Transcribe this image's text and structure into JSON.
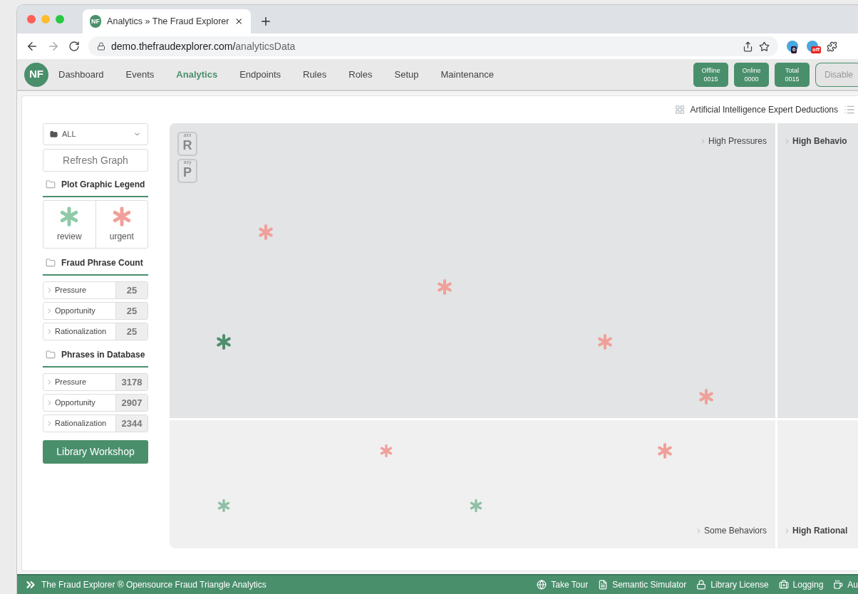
{
  "browser": {
    "favicon_text": "NF",
    "tab_title": "Analytics » The Fraud Explorer",
    "url_host": "demo.thefraudexplorer.com/",
    "url_path": "analyticsData",
    "extension_badges": [
      {
        "text": "0",
        "color": "#2a1636"
      },
      {
        "text": "off",
        "color": "#e8231c"
      }
    ]
  },
  "nav": {
    "logo": "NF",
    "items": [
      {
        "label": "Dashboard",
        "selected": false
      },
      {
        "label": "Events",
        "selected": false
      },
      {
        "label": "Analytics",
        "selected": true
      },
      {
        "label": "Endpoints",
        "selected": false
      },
      {
        "label": "Rules",
        "selected": false
      },
      {
        "label": "Roles",
        "selected": false
      },
      {
        "label": "Setup",
        "selected": false
      },
      {
        "label": "Maintenance",
        "selected": false
      }
    ],
    "status": [
      {
        "label": "Offline",
        "value": "0015"
      },
      {
        "label": "Online",
        "value": "0000"
      },
      {
        "label": "Total",
        "value": "0015"
      }
    ],
    "disable_button": "Disable"
  },
  "toolbar": {
    "title": "Artificial Intelligence Expert Deductions"
  },
  "sidebar": {
    "filter": "ALL",
    "refresh_button": "Refresh Graph",
    "legend": {
      "title": "Plot Graphic Legend",
      "items": [
        {
          "label": "review",
          "color": "#8fc9a8"
        },
        {
          "label": "urgent",
          "color": "#f0a09a"
        }
      ]
    },
    "sections": [
      {
        "title": "Fraud Phrase Count",
        "rows": [
          {
            "label": "Pressure",
            "value": "25"
          },
          {
            "label": "Opportunity",
            "value": "25"
          },
          {
            "label": "Rationalization",
            "value": "25"
          }
        ]
      },
      {
        "title": "Phrases in Database",
        "rows": [
          {
            "label": "Pressure",
            "value": "3178"
          },
          {
            "label": "Opportunity",
            "value": "2907"
          },
          {
            "label": "Rationalization",
            "value": "2344"
          }
        ]
      }
    ],
    "library_button": "Library Workshop"
  },
  "plot": {
    "axes": [
      {
        "caption": "axx",
        "letter": "R"
      },
      {
        "caption": "axy",
        "letter": "P"
      }
    ],
    "quadrants": [
      {
        "label": "High Pressures",
        "bold": false
      },
      {
        "label": "High Behavio",
        "bold": true
      },
      {
        "label": "Some Behaviors",
        "bold": false
      },
      {
        "label": "High Rational",
        "bold": true
      }
    ]
  },
  "footer": {
    "title": "The Fraud Explorer ® Opensource Fraud Triangle Analytics",
    "links": [
      {
        "kind": "globe",
        "label": "Take Tour"
      },
      {
        "kind": "document",
        "label": "Semantic Simulator"
      },
      {
        "kind": "lock",
        "label": "Library License"
      },
      {
        "kind": "medkit",
        "label": "Logging"
      },
      {
        "kind": "cup",
        "label": "Au"
      }
    ]
  }
}
